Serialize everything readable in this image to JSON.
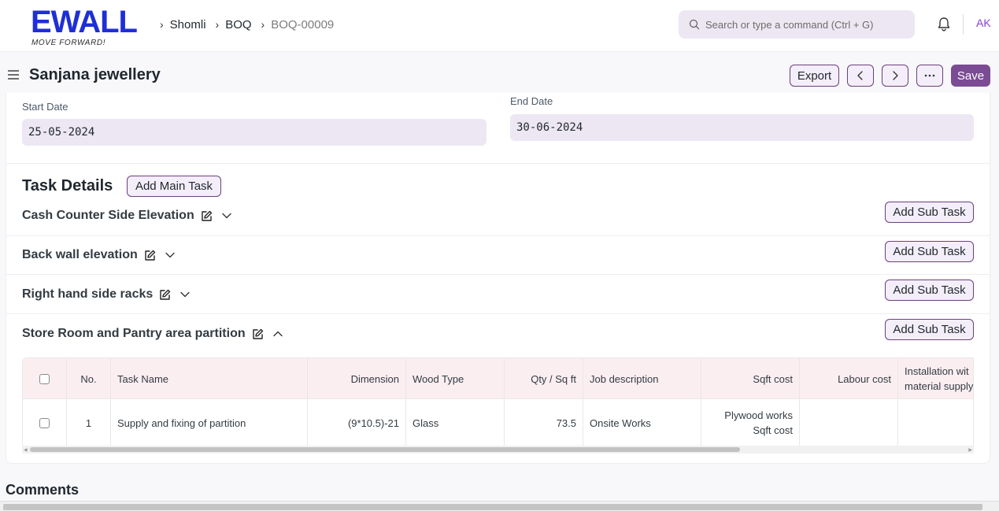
{
  "brand": {
    "logo_text": "EWALL",
    "tagline": "MOVE FORWARD!",
    "color": "#1f2fd6"
  },
  "breadcrumbs": [
    {
      "label": "Shomli"
    },
    {
      "label": "BOQ"
    },
    {
      "label": "BOQ-00009"
    }
  ],
  "search": {
    "placeholder": "Search or type a command (Ctrl + G)",
    "value": ""
  },
  "user": {
    "initials": "AK"
  },
  "icons": {
    "search": "search-icon",
    "bell": "bell-icon",
    "menu": "hamburger-icon",
    "edit": "edit-icon",
    "chevron_down": "chevron-down-icon",
    "chevron_up": "chevron-up-icon"
  },
  "page": {
    "title": "Sanjana jewellery",
    "actions": {
      "export": "Export",
      "prev": "‹",
      "next": "›",
      "more": "···",
      "save": "Save"
    }
  },
  "form": {
    "start_date": {
      "label": "Start Date",
      "value": "25-05-2024"
    },
    "end_date": {
      "label": "End Date",
      "value": "30-06-2024"
    }
  },
  "tasks": {
    "heading": "Task Details",
    "add_main_label": "Add Main Task",
    "add_sub_label": "Add Sub Task",
    "items": [
      {
        "name": "Cash Counter Side Elevation",
        "expanded": false
      },
      {
        "name": "Back wall elevation",
        "expanded": false
      },
      {
        "name": "Right hand side racks",
        "expanded": false
      },
      {
        "name": "Store Room and Pantry area partition",
        "expanded": true
      }
    ]
  },
  "grid": {
    "columns": [
      "No.",
      "Task Name",
      "Dimension",
      "Wood Type",
      "Qty / Sq ft",
      "Job description",
      "Sqft cost",
      "Labour cost",
      "Installation with material supply"
    ],
    "column_lines": {
      "installation": [
        "Installation wit",
        "material supply"
      ]
    },
    "rows": [
      {
        "no": "1",
        "task_name": "Supply and fixing of partition",
        "dimension": "(9*10.5)-21",
        "wood_type": "Glass",
        "qty": "73.5",
        "job_description": "Onsite Works",
        "sqft_cost": [
          "Plywood works",
          "Sqft cost"
        ],
        "labour_cost": "",
        "installation": ""
      }
    ]
  },
  "comments": {
    "heading": "Comments"
  },
  "colors": {
    "accent": "#7b4b94",
    "field_bg": "#ede7f3",
    "grid_header_bg": "#fbeef1"
  }
}
